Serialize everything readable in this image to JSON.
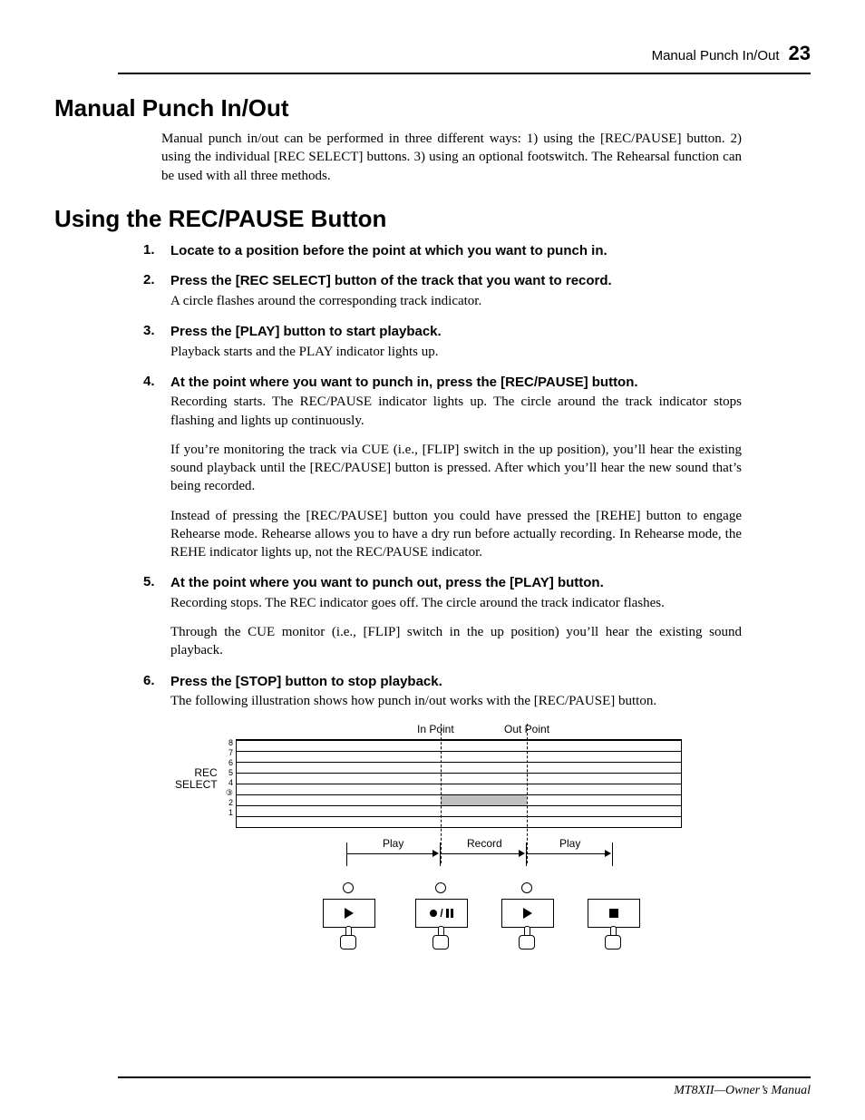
{
  "header": {
    "section": "Manual Punch In/Out",
    "page": "23"
  },
  "h1": "Manual Punch In/Out",
  "intro": "Manual punch in/out can be performed in three different ways: 1) using the [REC/PAUSE] button. 2) using the individual [REC SELECT] buttons. 3) using an optional footswitch. The Rehearsal function can be used with all three methods.",
  "h2": "Using the REC/PAUSE Button",
  "steps": [
    {
      "head": "Locate to a position before the point at which you want to punch in.",
      "paras": []
    },
    {
      "head": "Press the [REC SELECT] button of the track that you want to record.",
      "paras": [
        "A circle flashes around the corresponding track indicator."
      ]
    },
    {
      "head": "Press the [PLAY] button to start playback.",
      "paras": [
        "Playback starts and the PLAY indicator lights up."
      ]
    },
    {
      "head": "At the point where you want to punch in, press the [REC/PAUSE] button.",
      "paras": [
        "Recording starts. The REC/PAUSE indicator lights up. The circle around the track indicator stops flashing and lights up continuously.",
        "If you’re monitoring the track via CUE (i.e., [FLIP] switch in the up position), you’ll hear the existing sound playback until the [REC/PAUSE] button is pressed. After which you’ll hear the new sound that’s being recorded.",
        "Instead of pressing the [REC/PAUSE] button you could have pressed the [REHE] button to engage Rehearse mode. Rehearse allows you to have a dry run before actually recording. In Rehearse mode, the REHE indicator lights up, not the REC/PAUSE indicator."
      ]
    },
    {
      "head": "At the point where you want to punch out, press the [PLAY] button.",
      "paras": [
        "Recording stops. The REC indicator goes off. The circle around the track indicator flashes.",
        "Through the CUE monitor (i.e., [FLIP] switch in the up position) you’ll hear the existing sound playback."
      ]
    },
    {
      "head": "Press the [STOP] button to stop playback.",
      "paras": [
        "The following illustration shows how punch in/out works with the [REC/PAUSE] button."
      ]
    }
  ],
  "fig": {
    "inPoint": "In Point",
    "outPoint": "Out Point",
    "recSelect": "REC\nSELECT",
    "tracks": [
      "8",
      "7",
      "6",
      "5",
      "4",
      "③",
      "2",
      "1"
    ],
    "phases": [
      "Play",
      "Record",
      "Play"
    ]
  },
  "footer": "MT8XII—Owner’s Manual",
  "chart_data": {
    "type": "table",
    "title": "Punch In/Out timeline using REC/PAUSE button",
    "tracks": 8,
    "selected_track": 3,
    "events": [
      {
        "action": "PLAY",
        "result": "playback starts"
      },
      {
        "action": "REC/PAUSE",
        "at": "In Point",
        "result": "recording starts on track 3"
      },
      {
        "action": "PLAY",
        "at": "Out Point",
        "result": "recording stops, playback continues"
      },
      {
        "action": "STOP",
        "result": "playback stops"
      }
    ],
    "segments": [
      {
        "label": "Play",
        "from": "start",
        "to": "In Point"
      },
      {
        "label": "Record",
        "from": "In Point",
        "to": "Out Point"
      },
      {
        "label": "Play",
        "from": "Out Point",
        "to": "stop"
      }
    ]
  }
}
